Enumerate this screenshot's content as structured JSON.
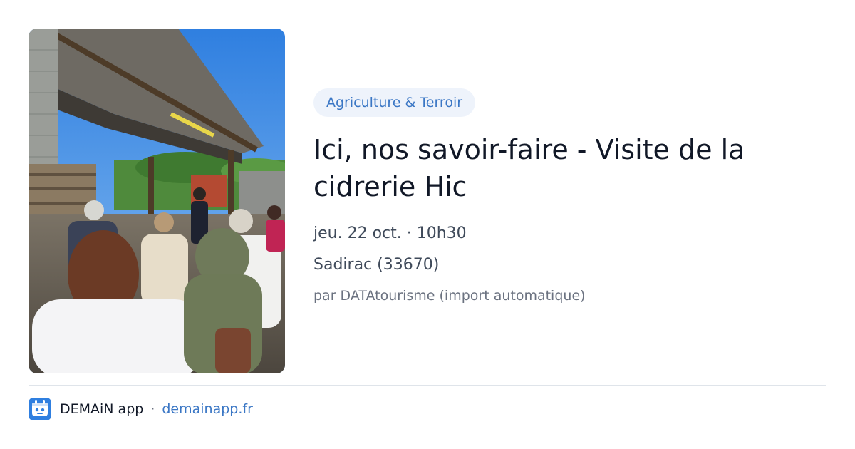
{
  "event": {
    "category": "Agriculture & Terroir",
    "title": "Ici, nos savoir-faire - Visite de la cidrerie Hic",
    "datetime": "jeu. 22 oct. · 10h30",
    "location": "Sadirac (33670)",
    "source": "par DATAtourisme (import automatique)",
    "image": "photo-group-visiting-cidery-under-shed"
  },
  "footer": {
    "app_name": "DEMAiN app",
    "separator": "·",
    "link": "demainapp.fr",
    "icon": "demain-app-icon"
  },
  "colors": {
    "tag_bg": "#eef3fb",
    "accent": "#3b77c5",
    "title": "#111827",
    "muted": "#6b7280",
    "divider": "#dfe4ea"
  }
}
